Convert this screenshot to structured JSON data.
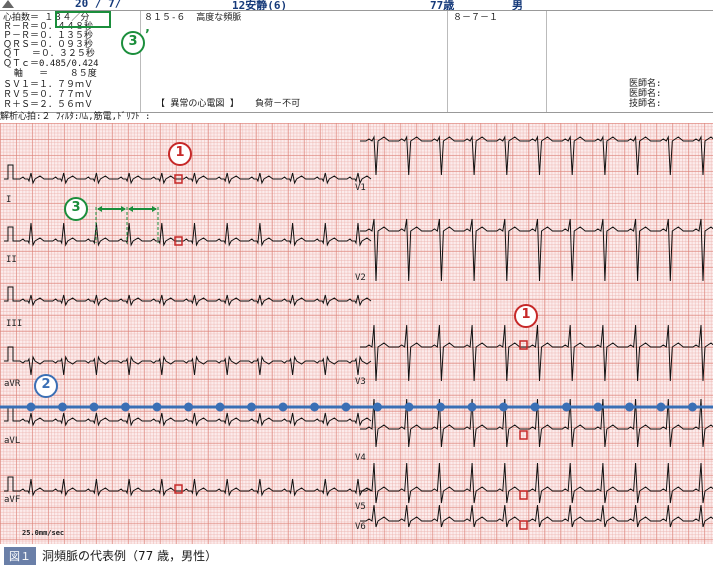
{
  "header": {
    "date": "20 / 7/",
    "exam": "12安静(6)",
    "age": "77歳",
    "sex": "男"
  },
  "measurements": {
    "lines": [
      "心拍数＝ １３４／分",
      "Ｒ－Ｒ＝０．４４８秒",
      "Ｐ－Ｒ＝０．１３５秒",
      "ＱＲＳ＝０．０９３秒",
      "ＱＴ  ＝０．３２５秒",
      "ＱＴｃ＝0.485/0.424",
      "  軸   ＝    ８５度",
      "ＳＶ１＝１．７９ｍＶ",
      "ＲＶ５＝０．７７ｍＶ",
      "Ｒ＋Ｓ＝２．５６ｍＶ"
    ],
    "findings": "８１５-６  高度な頻脈",
    "abnormal": "【 異常の心電図 】   負荷－不可",
    "code": "８－７－１",
    "signatures": [
      "医師名:",
      "医師名:",
      "技師名:"
    ]
  },
  "info_bar": "解析心拍:２      ﾌｨﾙﾀ:ﾊﾑ,筋電,ﾄﾞﾘﾌﾄ  :",
  "leads": {
    "left": [
      "I",
      "II",
      "III",
      "aVR",
      "aVL",
      "aVF"
    ],
    "right": [
      "V1",
      "V2",
      "V3",
      "V4",
      "V5",
      "V6"
    ]
  },
  "speed": "25.0mm/sec",
  "annotations": {
    "one": "1",
    "two": "2",
    "three": "3",
    "three_prime": "3",
    "prime_mark": "’"
  },
  "caption": {
    "badge": "図１",
    "text": "洞頻脈の代表例（77 歳，男性）"
  },
  "colors": {
    "trace": "#111111",
    "highlight_red": "#c62828",
    "highlight_green": "#1b8e3c",
    "guide_blue": "#3a6fb5"
  }
}
